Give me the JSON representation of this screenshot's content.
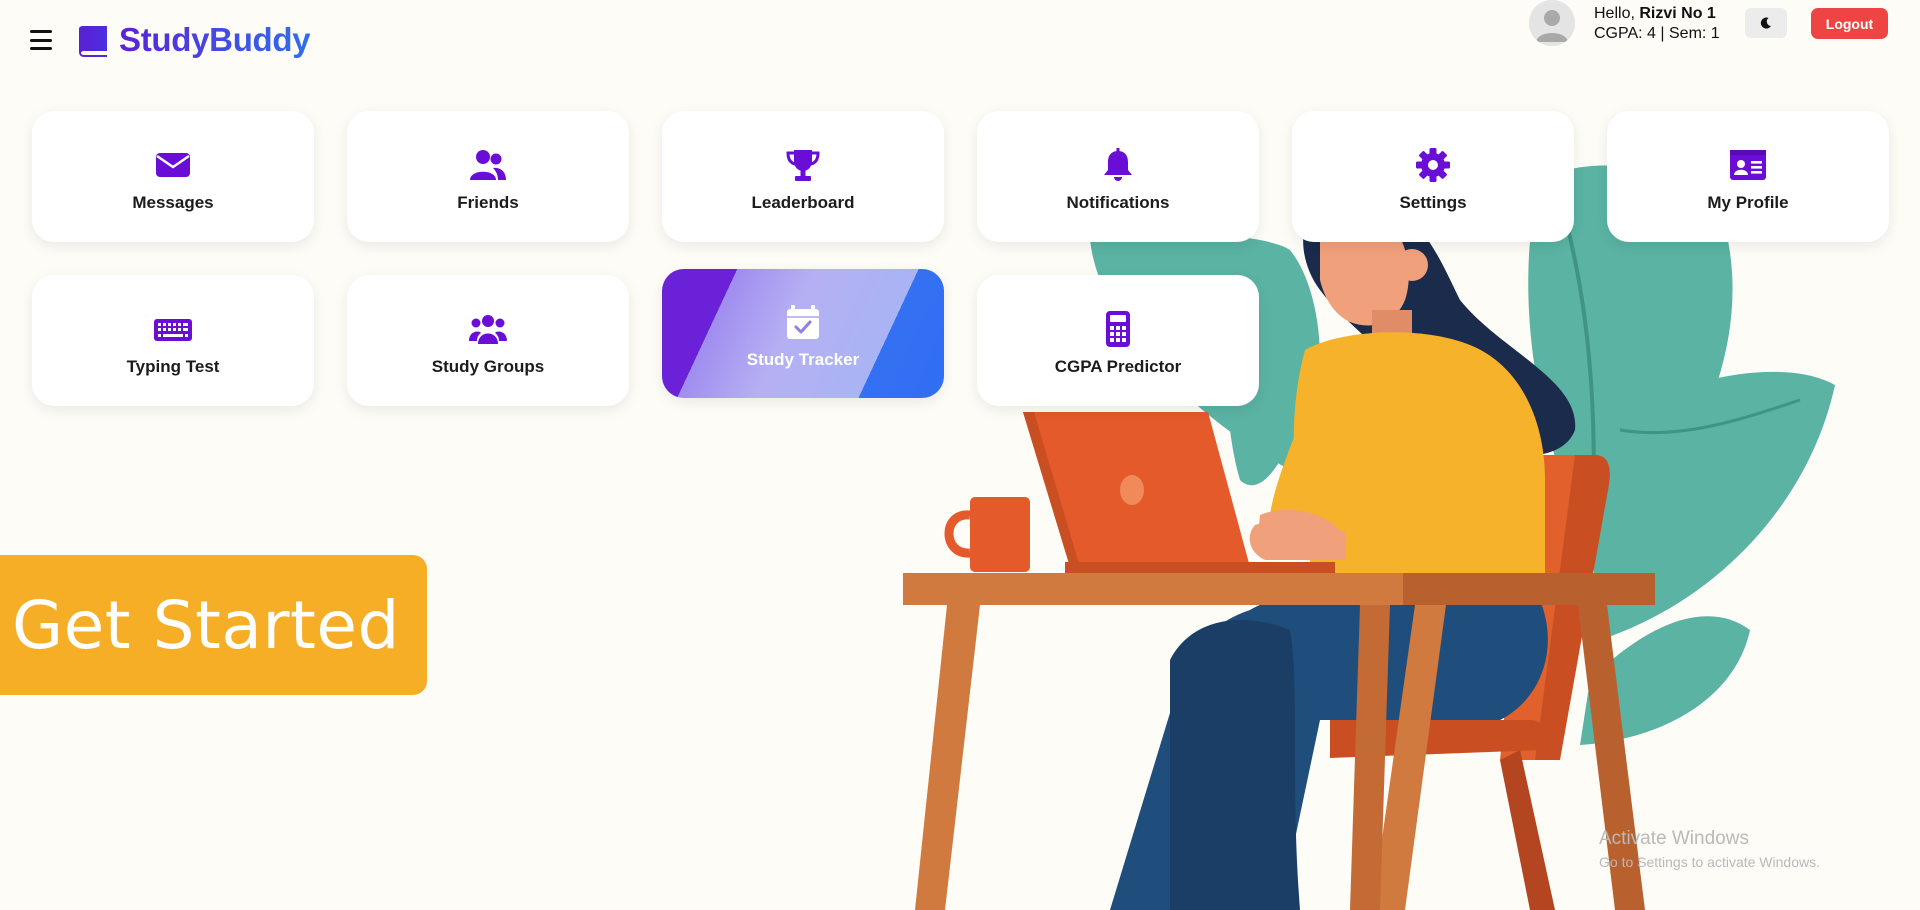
{
  "app": {
    "name": "StudyBuddy"
  },
  "header": {
    "greeting_prefix": "Hello,",
    "user_name": "Rizvi No 1",
    "stats": "CGPA: 4 | Sem: 1",
    "logout_label": "Logout"
  },
  "tiles": [
    {
      "label": "Messages",
      "icon": "envelope-icon"
    },
    {
      "label": "Friends",
      "icon": "users-icon"
    },
    {
      "label": "Leaderboard",
      "icon": "trophy-icon"
    },
    {
      "label": "Notifications",
      "icon": "bell-icon"
    },
    {
      "label": "Settings",
      "icon": "gear-icon"
    },
    {
      "label": "My Profile",
      "icon": "id-card-icon"
    },
    {
      "label": "Typing Test",
      "icon": "keyboard-icon"
    },
    {
      "label": "Study Groups",
      "icon": "group-icon"
    },
    {
      "label": "Study Tracker",
      "icon": "calendar-check-icon",
      "active": true
    },
    {
      "label": "CGPA Predictor",
      "icon": "calculator-icon"
    }
  ],
  "hero": {
    "cta_label": "Get Started"
  },
  "watermark": {
    "line1": "Activate Windows",
    "line2": "Go to Settings to activate Windows."
  },
  "colors": {
    "icon_purple": "#6a0dd6",
    "brand_start": "#5b21d6",
    "brand_end": "#2f6fed",
    "cta": "#f6ae26",
    "logout": "#ef4444",
    "background": "#fdfcf6"
  }
}
